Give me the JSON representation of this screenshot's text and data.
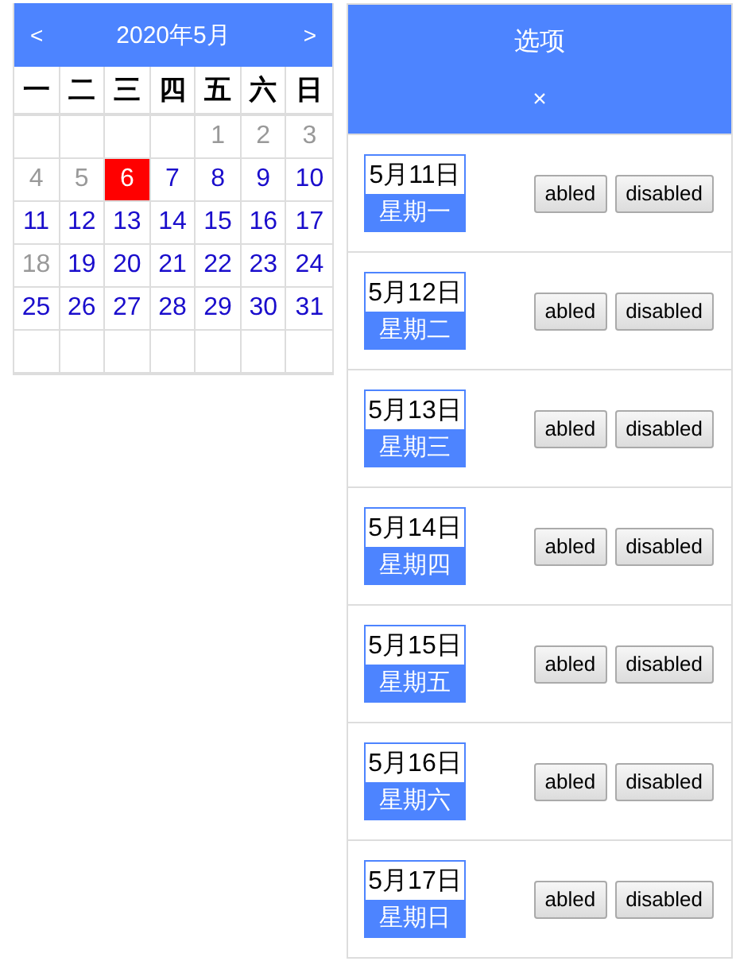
{
  "calendar": {
    "prev": "<",
    "title": "2020年5月",
    "next": ">",
    "weekdays": [
      "一",
      "二",
      "三",
      "四",
      "五",
      "六",
      "日"
    ],
    "weeks": [
      [
        {
          "kind": "empty"
        },
        {
          "kind": "empty"
        },
        {
          "kind": "empty"
        },
        {
          "kind": "empty"
        },
        {
          "kind": "day",
          "day": "1",
          "muted": true,
          "selected": false
        },
        {
          "kind": "day",
          "day": "2",
          "muted": true,
          "selected": false
        },
        {
          "kind": "day",
          "day": "3",
          "muted": true,
          "selected": false
        }
      ],
      [
        {
          "kind": "day",
          "day": "4",
          "muted": true,
          "selected": false
        },
        {
          "kind": "day",
          "day": "5",
          "muted": true,
          "selected": false
        },
        {
          "kind": "day",
          "day": "6",
          "muted": false,
          "selected": true
        },
        {
          "kind": "day",
          "day": "7",
          "muted": false,
          "selected": false
        },
        {
          "kind": "day",
          "day": "8",
          "muted": false,
          "selected": false
        },
        {
          "kind": "day",
          "day": "9",
          "muted": false,
          "selected": false
        },
        {
          "kind": "day",
          "day": "10",
          "muted": false,
          "selected": false
        }
      ],
      [
        {
          "kind": "day",
          "day": "11",
          "muted": false,
          "selected": false
        },
        {
          "kind": "day",
          "day": "12",
          "muted": false,
          "selected": false
        },
        {
          "kind": "day",
          "day": "13",
          "muted": false,
          "selected": false
        },
        {
          "kind": "day",
          "day": "14",
          "muted": false,
          "selected": false
        },
        {
          "kind": "day",
          "day": "15",
          "muted": false,
          "selected": false
        },
        {
          "kind": "day",
          "day": "16",
          "muted": false,
          "selected": false
        },
        {
          "kind": "day",
          "day": "17",
          "muted": false,
          "selected": false
        }
      ],
      [
        {
          "kind": "day",
          "day": "18",
          "muted": true,
          "selected": false
        },
        {
          "kind": "day",
          "day": "19",
          "muted": false,
          "selected": false
        },
        {
          "kind": "day",
          "day": "20",
          "muted": false,
          "selected": false
        },
        {
          "kind": "day",
          "day": "21",
          "muted": false,
          "selected": false
        },
        {
          "kind": "day",
          "day": "22",
          "muted": false,
          "selected": false
        },
        {
          "kind": "day",
          "day": "23",
          "muted": false,
          "selected": false
        },
        {
          "kind": "day",
          "day": "24",
          "muted": false,
          "selected": false
        }
      ],
      [
        {
          "kind": "day",
          "day": "25",
          "muted": false,
          "selected": false
        },
        {
          "kind": "day",
          "day": "26",
          "muted": false,
          "selected": false
        },
        {
          "kind": "day",
          "day": "27",
          "muted": false,
          "selected": false
        },
        {
          "kind": "day",
          "day": "28",
          "muted": false,
          "selected": false
        },
        {
          "kind": "day",
          "day": "29",
          "muted": false,
          "selected": false
        },
        {
          "kind": "day",
          "day": "30",
          "muted": false,
          "selected": false
        },
        {
          "kind": "day",
          "day": "31",
          "muted": false,
          "selected": false
        }
      ],
      [
        {
          "kind": "empty"
        },
        {
          "kind": "empty"
        },
        {
          "kind": "empty"
        },
        {
          "kind": "empty"
        },
        {
          "kind": "empty"
        },
        {
          "kind": "empty"
        },
        {
          "kind": "empty"
        }
      ]
    ]
  },
  "panel": {
    "title": "选项",
    "close": "×",
    "items": [
      {
        "date": "5月11日",
        "weekday": "星期一",
        "buttons": [
          "abled",
          "disabled"
        ]
      },
      {
        "date": "5月12日",
        "weekday": "星期二",
        "buttons": [
          "abled",
          "disabled"
        ]
      },
      {
        "date": "5月13日",
        "weekday": "星期三",
        "buttons": [
          "abled",
          "disabled"
        ]
      },
      {
        "date": "5月14日",
        "weekday": "星期四",
        "buttons": [
          "abled",
          "disabled"
        ]
      },
      {
        "date": "5月15日",
        "weekday": "星期五",
        "buttons": [
          "abled",
          "disabled"
        ]
      },
      {
        "date": "5月16日",
        "weekday": "星期六",
        "buttons": [
          "abled",
          "disabled"
        ]
      },
      {
        "date": "5月17日",
        "weekday": "星期日",
        "buttons": [
          "abled",
          "disabled"
        ]
      }
    ]
  }
}
